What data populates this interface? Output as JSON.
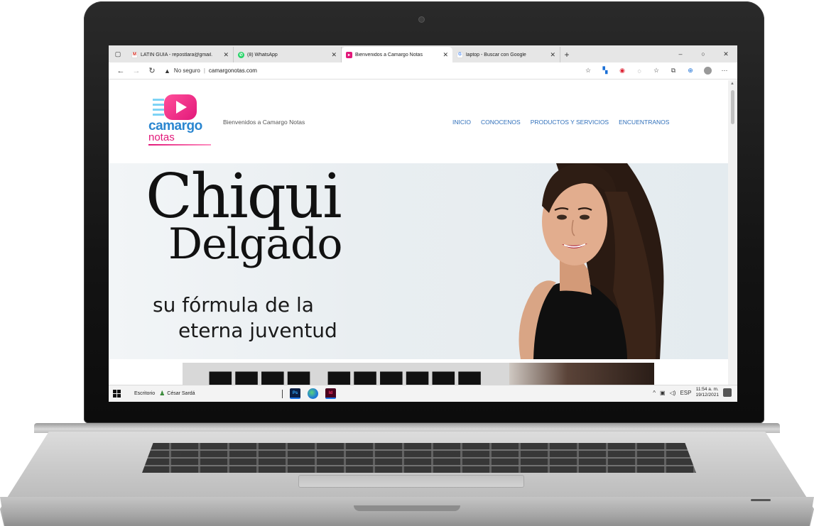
{
  "browser": {
    "tabs": [
      {
        "label": "LATIN GUIA - repostlara@gmail.",
        "favicon": "gmail-icon",
        "active": false
      },
      {
        "label": "(8) WhatsApp",
        "favicon": "whatsapp-icon",
        "active": false
      },
      {
        "label": "Bienvenidos a Camargo Notas",
        "favicon": "camargo-notas-icon",
        "active": true
      },
      {
        "label": "laptop - Buscar con Google",
        "favicon": "google-icon",
        "active": false
      }
    ],
    "new_tab": "+",
    "window_controls": {
      "minimize": "–",
      "restore": "○",
      "close": "✕"
    },
    "security_label": "No seguro",
    "url": "camargonotas.com"
  },
  "site": {
    "logo_word1": "camargo",
    "logo_word2": "notas",
    "tagline": "Bienvenidos a Camargo Notas",
    "menu": [
      "INICIO",
      "CONOCENOS",
      "PRODUCTOS Y SERVICIOS",
      "ENCUENTRANOS"
    ]
  },
  "hero": {
    "title_line1": "Chiqui",
    "title_line2": "Delgado",
    "subtitle_line1": "su fórmula de la",
    "subtitle_line2": "eterna juventud"
  },
  "taskbar": {
    "label": "Escritorio",
    "user": "César Sardá",
    "apps": [
      "Ps",
      "Edge",
      "Id"
    ],
    "language": "ESP",
    "time": "11:54 a. m.",
    "date": "19/12/2021"
  },
  "colors": {
    "brand_pink": "#e2187a",
    "brand_blue": "#2a86d0",
    "menu_link": "#2f6fba"
  }
}
